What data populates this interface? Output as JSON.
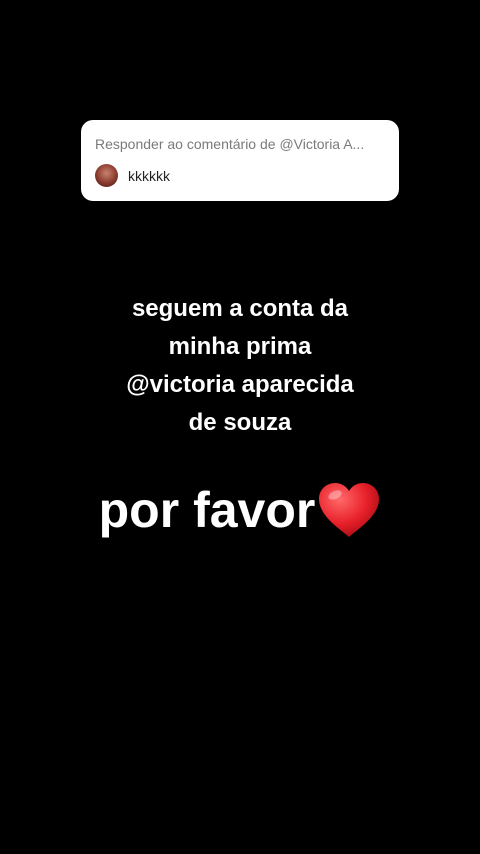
{
  "reply": {
    "header": "Responder ao comentário de @Victoria A...",
    "comment": "kkkkkk"
  },
  "caption": {
    "lines": [
      "seguem a conta da",
      "minha prima",
      "@victoria aparecida",
      "de souza"
    ]
  },
  "plea": {
    "text": "por favor",
    "emoji_icon": "red-heart-icon"
  },
  "colors": {
    "background": "#000000",
    "text": "#ffffff",
    "heart": "#e8202a"
  }
}
